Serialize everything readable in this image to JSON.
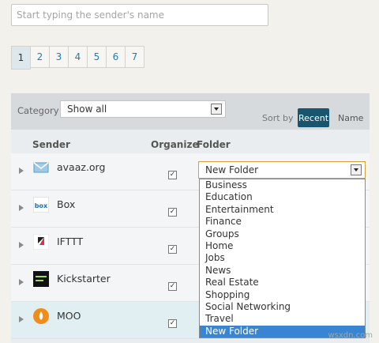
{
  "search": {
    "placeholder": "Start typing the sender's name",
    "value": ""
  },
  "pagination": [
    "1",
    "2",
    "3",
    "4",
    "5",
    "6",
    "7"
  ],
  "filter": {
    "category_label": "Category",
    "category_value": "Show all",
    "sort_by_label": "Sort by",
    "sort_recent": "Recent",
    "sort_name": "Name"
  },
  "columns": {
    "sender": "Sender",
    "organize": "Organize",
    "folder": "Folder"
  },
  "senders": [
    {
      "name": "avaaz.org",
      "logo": "avaaz-envelope-icon",
      "organize": true
    },
    {
      "name": "Box",
      "logo": "box-logo-icon",
      "organize": true
    },
    {
      "name": "IFTTT",
      "logo": "ifttt-logo-icon",
      "organize": true
    },
    {
      "name": "Kickstarter",
      "logo": "kickstarter-logo-icon",
      "organize": true
    },
    {
      "name": "MOO",
      "logo": "moo-logo-icon",
      "organize": true
    }
  ],
  "folder_dropdown": {
    "selected": "New Folder",
    "options": [
      "Business",
      "Education",
      "Entertainment",
      "Finance",
      "Groups",
      "Home",
      "Jobs",
      "News",
      "Real Estate",
      "Shopping",
      "Social Networking",
      "Travel",
      "New Folder"
    ]
  },
  "watermark": "wsxdn.com",
  "colors": {
    "accent": "#17566e",
    "link": "#1f7db2",
    "selection": "#3a84d4",
    "focus_border": "#d3a33a"
  }
}
